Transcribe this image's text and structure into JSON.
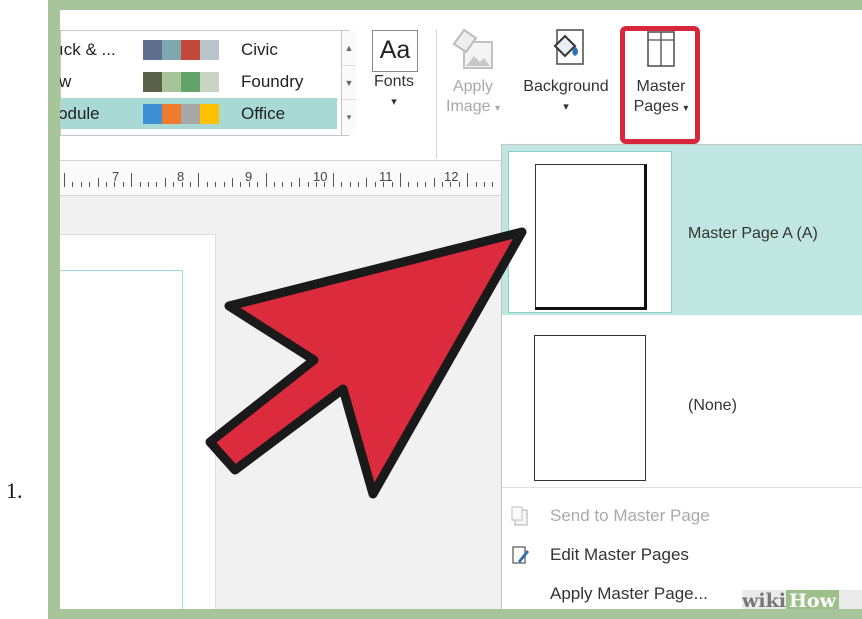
{
  "step_number": "1.",
  "scheme_gallery": {
    "rows": [
      {
        "left_name": "ıck & ...",
        "right_name": "Civic",
        "swatches": [
          "#5f6f8f",
          "#7fa7ae",
          "#c24a3a",
          "#b8c4cc"
        ]
      },
      {
        "left_name": "w",
        "right_name": "Foundry",
        "swatches": [
          "#5b6048",
          "#a7c39a",
          "#63a36a",
          "#c9d4c3"
        ]
      },
      {
        "left_name": "ɔdule",
        "right_name": "Office",
        "swatches": [
          "#3d8fd6",
          "#ee7b2e",
          "#a8a8a8",
          "#ffc000"
        ],
        "selected": true
      }
    ],
    "scroll": {
      "up": "▲",
      "down": "▼",
      "more": "▾"
    }
  },
  "ribbon": {
    "fonts": {
      "glyph": "Aa",
      "label": "Fonts",
      "arrow": "▾",
      "icon": "fonts-icon"
    },
    "apply_image": {
      "line1": "Apply",
      "line2": "Image",
      "arrow": "▾",
      "icon": "apply-image-icon",
      "disabled": true
    },
    "background": {
      "label": "Background",
      "arrow": "▾",
      "icon": "paint-bucket-icon"
    },
    "master_pages": {
      "line1": "Master",
      "line2": "Pages",
      "arrow": "▾",
      "icon": "master-pages-icon",
      "highlight_color": "#d8263a"
    }
  },
  "ruler": {
    "numbers": [
      "7",
      "8",
      "9",
      "10",
      "11",
      "12"
    ]
  },
  "master_page_dropdown": {
    "items": [
      {
        "label": "Master Page A (A)",
        "selected": true
      },
      {
        "label": "(None)",
        "selected": false
      }
    ],
    "menu": [
      {
        "label": "Send to Master Page",
        "disabled": true,
        "icon": "send-to-master-icon"
      },
      {
        "label": "Edit Master Pages",
        "disabled": false,
        "icon": "edit-master-icon"
      },
      {
        "label": "Apply Master Page...",
        "disabled": false,
        "icon": ""
      }
    ]
  },
  "annotation": {
    "arrow_color": "#dc2b3c",
    "outline_color": "#1a1a1a"
  },
  "watermark": {
    "part1": "wiki",
    "part2": "How"
  }
}
